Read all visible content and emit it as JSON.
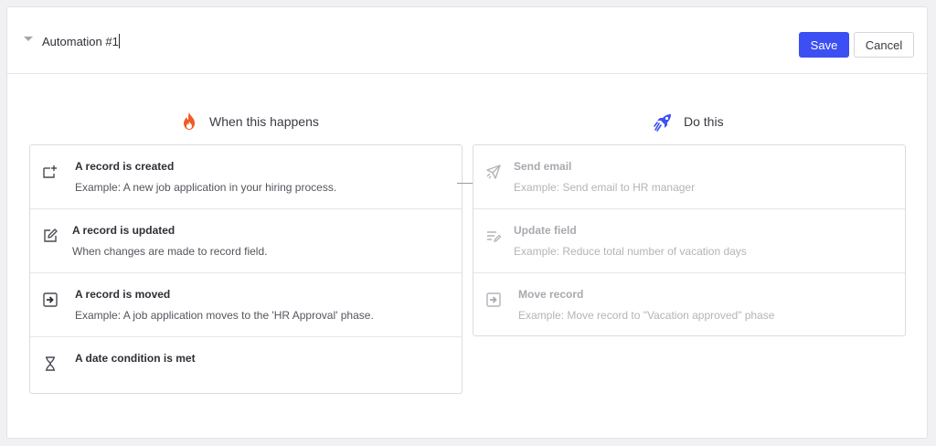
{
  "header": {
    "title_value": "Automation #1",
    "save_label": "Save",
    "cancel_label": "Cancel"
  },
  "colors": {
    "primary": "#3b4ff2",
    "trigger_heading_icon": "#f05a28",
    "action_heading_icon": "#3b4ff2",
    "muted_text": "#a9a9af"
  },
  "triggers": {
    "heading": "When this happens",
    "heading_icon": "fire-icon",
    "items": [
      {
        "title": "A record is created",
        "description": "Example: A new job application in your hiring process.",
        "icon": "record-add-icon"
      },
      {
        "title": "A record is updated",
        "description": "When changes are made to record field.",
        "icon": "edit-icon"
      },
      {
        "title": "A record is moved",
        "description": "Example: A job application moves to the 'HR Approval' phase.",
        "icon": "move-arrow-icon"
      },
      {
        "title": "A date condition is met",
        "description": "",
        "icon": "hourglass-icon"
      }
    ]
  },
  "actions": {
    "heading": "Do this",
    "heading_icon": "rocket-icon",
    "items": [
      {
        "title": "Send email",
        "description": "Example: Send email to HR manager",
        "icon": "send-icon"
      },
      {
        "title": "Update field",
        "description": "Example: Reduce total number of vacation days",
        "icon": "update-field-icon"
      },
      {
        "title": "Move record",
        "description": "Example: Move record to \"Vacation approved\" phase",
        "icon": "move-arrow-icon"
      }
    ]
  }
}
